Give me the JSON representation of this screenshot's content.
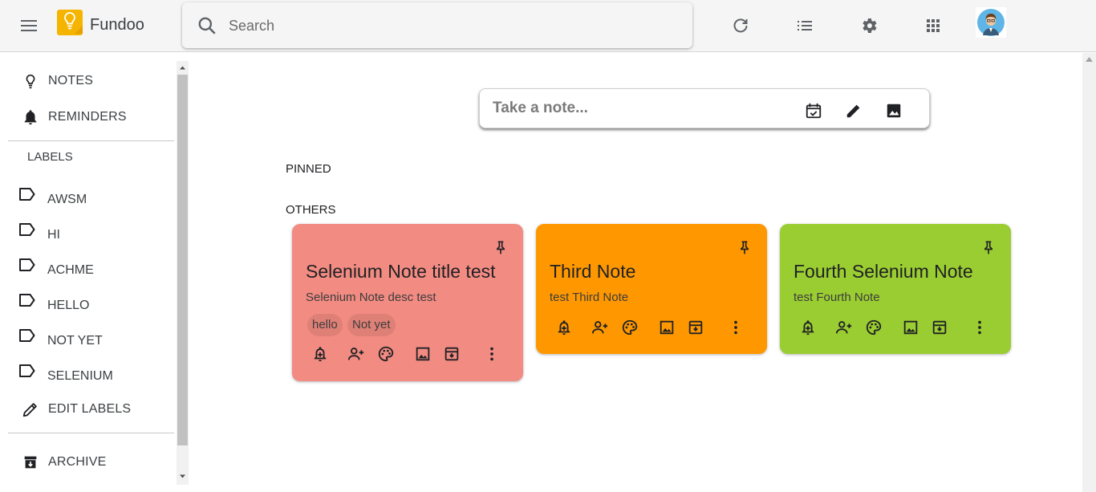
{
  "header": {
    "app_title": "Fundoo",
    "search_placeholder": "Search",
    "icons": [
      "menu-icon",
      "lightbulb-logo-icon",
      "search-icon",
      "refresh-icon",
      "list-view-icon",
      "gear-icon",
      "apps-grid-icon",
      "avatar"
    ]
  },
  "sidebar": {
    "nav": [
      {
        "label": "NOTES",
        "icon": "lightbulb-icon"
      },
      {
        "label": "REMINDERS",
        "icon": "bell-icon"
      }
    ],
    "labels_heading": "LABELS",
    "labels": [
      {
        "label": "AWSM",
        "icon": "label-icon"
      },
      {
        "label": "HI",
        "icon": "label-icon"
      },
      {
        "label": "ACHME",
        "icon": "label-icon"
      },
      {
        "label": "HELLO",
        "icon": "label-icon"
      },
      {
        "label": "NOT YET",
        "icon": "label-icon"
      },
      {
        "label": "SELENIUM",
        "icon": "label-icon"
      }
    ],
    "edit_labels": "EDIT LABELS",
    "archive": "ARCHIVE"
  },
  "take_note": {
    "placeholder": "Take a note...",
    "icons": [
      "checklist-calendar-icon",
      "pencil-icon",
      "image-icon"
    ]
  },
  "sections": {
    "pinned": "PINNED",
    "others": "OTHERS"
  },
  "notes": [
    {
      "title": "Selenium Note title test",
      "description": "Selenium Note desc test",
      "labels": [
        "hello",
        "Not yet"
      ],
      "color": "#f28b82"
    },
    {
      "title": "Third Note",
      "description": "test Third Note",
      "labels": [],
      "color": "#ff9800"
    },
    {
      "title": "Fourth Selenium Note",
      "description": "test Fourth Note",
      "labels": [],
      "color": "#9acd32"
    }
  ],
  "note_action_icons": [
    "reminder-bell-icon",
    "collaborator-icon",
    "palette-icon",
    "image-icon",
    "archive-icon",
    "more-vert-icon"
  ]
}
